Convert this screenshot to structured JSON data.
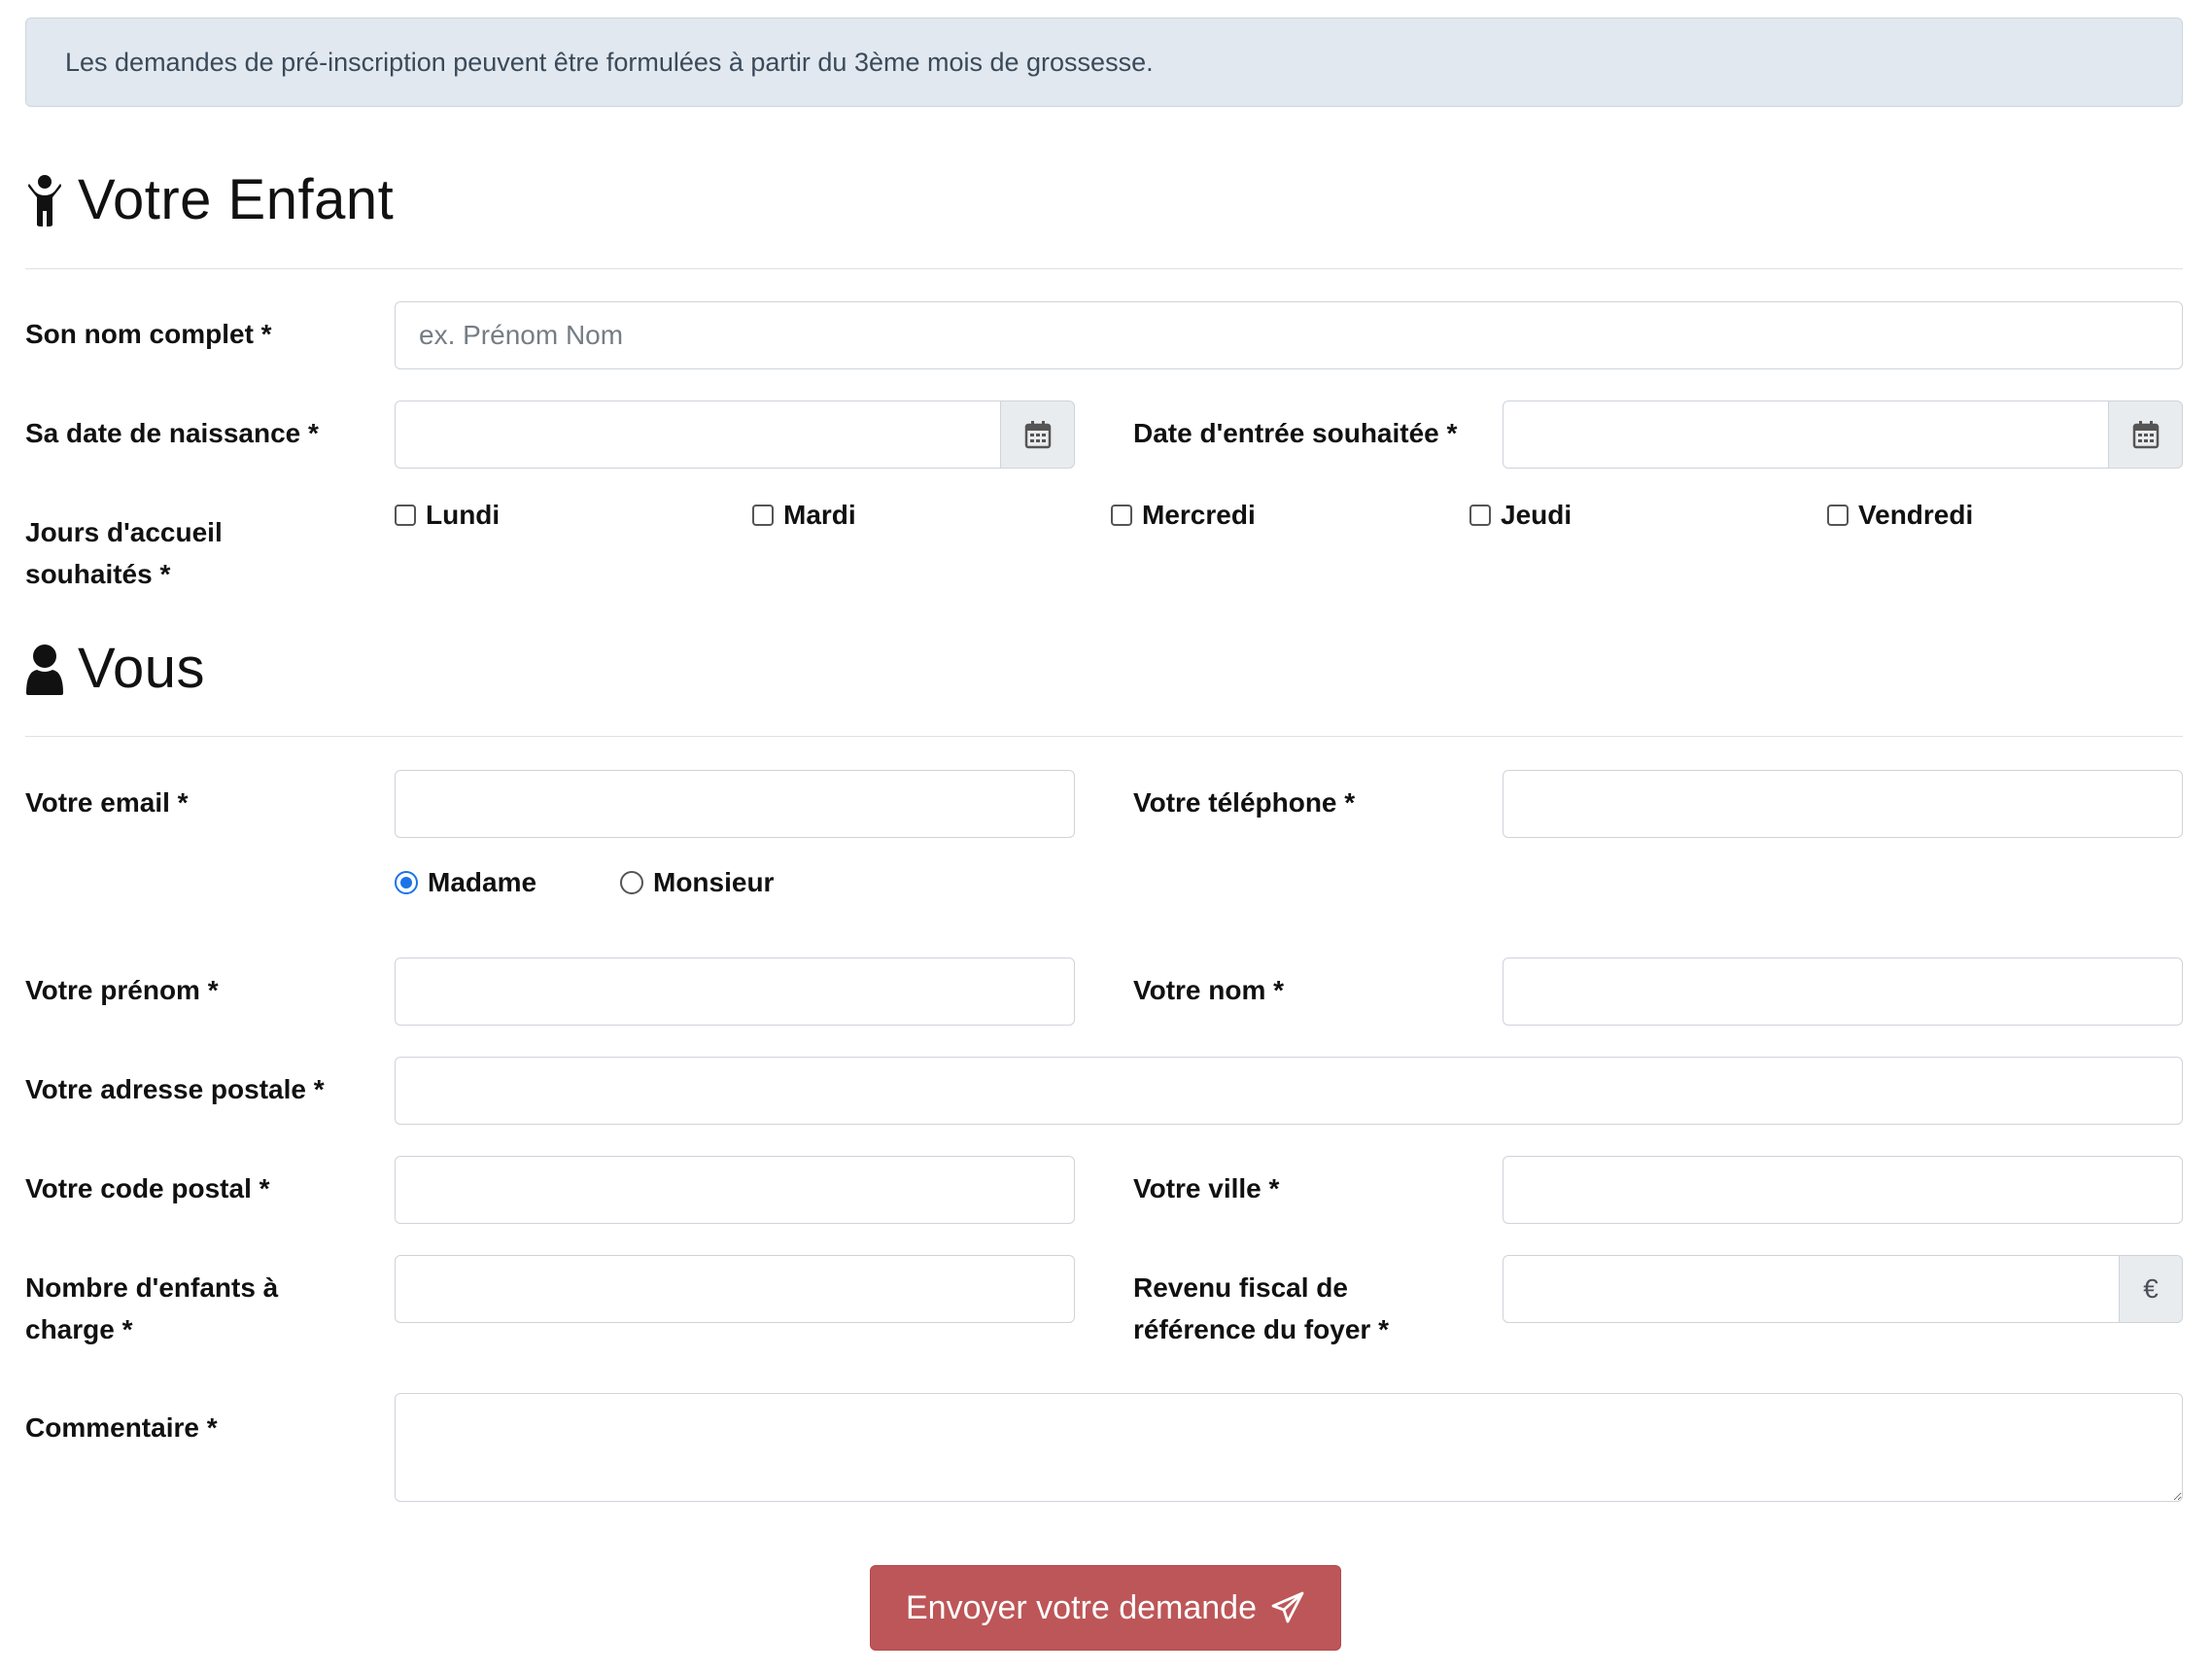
{
  "alert": "Les demandes de pré-inscription peuvent être formulées à partir du 3ème mois de grossesse.",
  "child_section": {
    "title": "Votre Enfant",
    "icon": "child-icon",
    "full_name_label": "Son nom complet *",
    "full_name_placeholder": "ex. Prénom Nom",
    "birth_date_label": "Sa date de naissance *",
    "entry_date_label": "Date d'entrée souhaitée *",
    "days_label": "Jours d'accueil souhaités *",
    "days": [
      "Lundi",
      "Mardi",
      "Mercredi",
      "Jeudi",
      "Vendredi"
    ]
  },
  "you_section": {
    "title": "Vous",
    "icon": "user-icon",
    "email_label": "Votre email *",
    "phone_label": "Votre téléphone *",
    "civility_options": [
      "Madame",
      "Monsieur"
    ],
    "civility_selected": "Madame",
    "first_name_label": "Votre prénom *",
    "last_name_label": "Votre nom *",
    "address_label": "Votre adresse postale *",
    "postal_code_label": "Votre code postal *",
    "city_label": "Votre ville *",
    "children_count_label": "Nombre d'enfants à charge *",
    "income_label": "Revenu fiscal de référence du foyer *",
    "currency": "€",
    "comment_label": "Commentaire *"
  },
  "submit_label": "Envoyer votre demande",
  "colors": {
    "alert_bg": "#e1e8ef",
    "submit_bg": "#bd5658",
    "radio_accent": "#1a73e8"
  }
}
